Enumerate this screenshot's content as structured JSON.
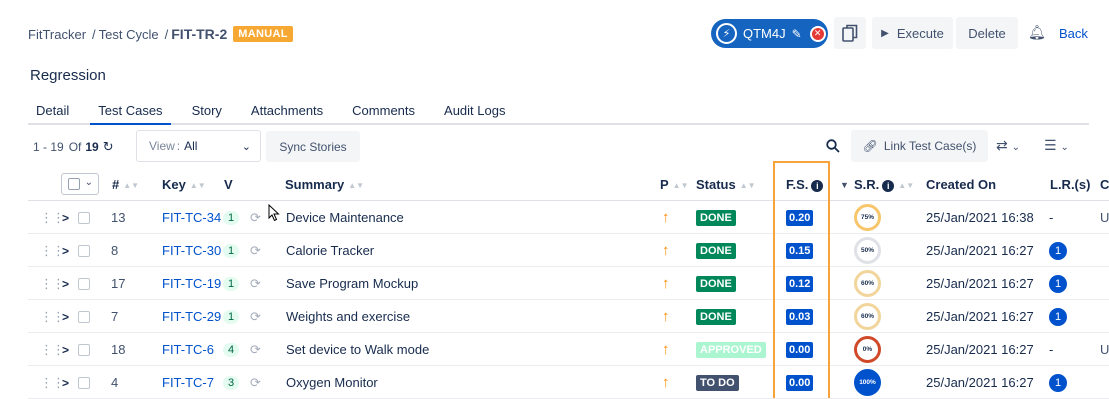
{
  "breadcrumb": {
    "project": "FitTracker",
    "section": "Test Cycle",
    "current": "FIT-TR-2",
    "badge": "MANUAL"
  },
  "header_buttons": {
    "qtm": "QTM4J",
    "execute": "Execute",
    "delete": "Delete",
    "back": "Back"
  },
  "page_title": "Regression",
  "tabs": [
    "Detail",
    "Test Cases",
    "Story",
    "Attachments",
    "Comments",
    "Audit Logs"
  ],
  "toolbar": {
    "range": "1 - 19",
    "of": "Of",
    "total": "19",
    "view_label": "View",
    "view_value": "All",
    "sync_stories": "Sync Stories",
    "link_test_cases": "Link Test Case(s)"
  },
  "columns": {
    "num": "#",
    "key": "Key",
    "v": "V",
    "summary": "Summary",
    "p": "P",
    "status": "Status",
    "fs": "F.S.",
    "sr": "S.R.",
    "created_on": "Created On",
    "lr": "L.R.(s)",
    "cut": "C"
  },
  "colors": {
    "done": "#00875a",
    "approved": "#abf5d1",
    "todo": "#42526e",
    "accent": "#0052cc",
    "highlight": "#f7a33c"
  },
  "rows": [
    {
      "num": "13",
      "key": "FIT-TC-34",
      "v": "1",
      "summary": "Device Maintenance",
      "status": "DONE",
      "fs": "0.20",
      "sr": "75%",
      "created": "25/Jan/2021 16:38",
      "lr": "-",
      "trail": "U"
    },
    {
      "num": "8",
      "key": "FIT-TC-30",
      "v": "1",
      "summary": "Calorie Tracker",
      "status": "DONE",
      "fs": "0.15",
      "sr": "50%",
      "created": "25/Jan/2021 16:27",
      "lr": "1",
      "trail": ""
    },
    {
      "num": "17",
      "key": "FIT-TC-19",
      "v": "1",
      "summary": "Save Program Mockup",
      "status": "DONE",
      "fs": "0.12",
      "sr": "60%",
      "created": "25/Jan/2021 16:27",
      "lr": "1",
      "trail": ""
    },
    {
      "num": "7",
      "key": "FIT-TC-29",
      "v": "1",
      "summary": "Weights and exercise",
      "status": "DONE",
      "fs": "0.03",
      "sr": "60%",
      "created": "25/Jan/2021 16:27",
      "lr": "1",
      "trail": ""
    },
    {
      "num": "18",
      "key": "FIT-TC-6",
      "v": "4",
      "summary": "Set device to Walk mode",
      "status": "APPROVED",
      "fs": "0.00",
      "sr": "0%",
      "created": "25/Jan/2021 16:27",
      "lr": "-",
      "trail": "U"
    },
    {
      "num": "4",
      "key": "FIT-TC-7",
      "v": "3",
      "summary": "Oxygen Monitor",
      "status": "TO DO",
      "fs": "0.00",
      "sr": "100%",
      "created": "25/Jan/2021 16:27",
      "lr": "1",
      "trail": ""
    }
  ]
}
